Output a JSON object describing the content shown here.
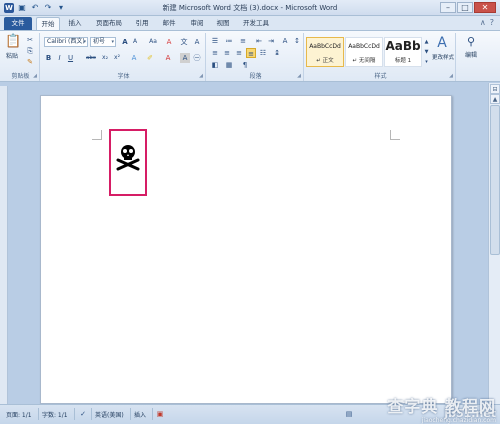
{
  "window": {
    "title": "新建 Microsoft Word 文档 (3).docx - Microsoft Word",
    "app_icon": "W",
    "qat_icons": [
      "save-icon",
      "undo-icon",
      "redo-icon",
      "customize-icon"
    ]
  },
  "tabs": [
    "文件",
    "开始",
    "插入",
    "页面布局",
    "引用",
    "邮件",
    "审阅",
    "视图",
    "开发工具"
  ],
  "ribbon": {
    "clipboard": {
      "paste": "粘贴",
      "label": "剪贴板"
    },
    "font": {
      "font_name": "Calibri (西文)",
      "font_size": "初号",
      "bold": "B",
      "italic": "I",
      "underline": "U",
      "strike": "abc",
      "sub": "x₂",
      "sup": "x²",
      "grow": "A",
      "shrink": "A",
      "case": "Aa",
      "clear": "A",
      "label": "字体"
    },
    "paragraph": {
      "label": "段落"
    },
    "styles": {
      "items": [
        {
          "sample": "AaBbCcDd",
          "name": "↵ 正文"
        },
        {
          "sample": "AaBbCcDd",
          "name": "↵ 无间隔"
        },
        {
          "sample": "AaBb",
          "name": "标题 1"
        }
      ],
      "change": "更改样式",
      "label": "样式"
    },
    "editing": {
      "label": "编辑"
    }
  },
  "status": {
    "page": "页面: 1/1",
    "words": "字数: 1/1",
    "lang": "英语(美国)",
    "insert": "插入"
  },
  "watermark": {
    "line1": "jb51.net",
    "line2": "查字典 教程网",
    "line3": "jiaocheng.chazidian.com"
  }
}
